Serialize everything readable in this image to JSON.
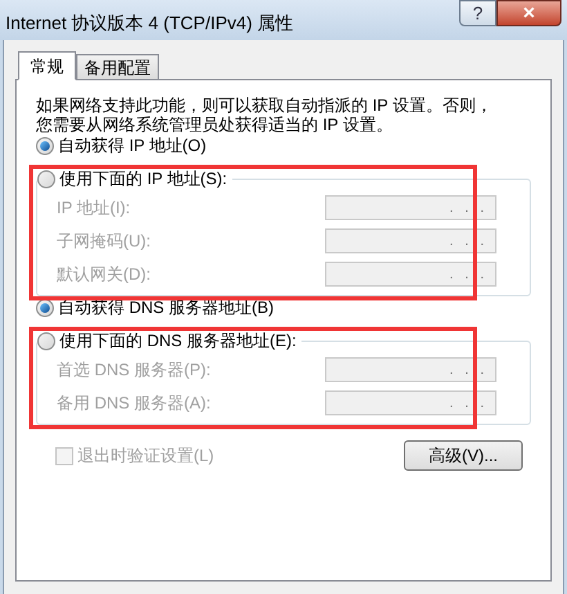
{
  "window": {
    "title": "Internet 协议版本 4 (TCP/IPv4) 属性",
    "help_button": "?",
    "close_button": "×"
  },
  "tabs": [
    {
      "label": "常规",
      "selected": true
    },
    {
      "label": "备用配置",
      "selected": false
    }
  ],
  "description": "如果网络支持此功能，则可以获取自动指派的 IP 设置。否则，您需要从网络系统管理员处获得适当的 IP 设置。",
  "ip_section": {
    "options": [
      {
        "label": "自动获得 IP 地址(O)",
        "selected": true
      },
      {
        "label": "使用下面的 IP 地址(S):",
        "selected": false
      }
    ],
    "highlighted": true,
    "fields": [
      {
        "label": "IP 地址(I):",
        "value": ".   .   .",
        "disabled": true
      },
      {
        "label": "子网掩码(U):",
        "value": ".   .   .",
        "disabled": true
      },
      {
        "label": "默认网关(D):",
        "value": ".   .   .",
        "disabled": true
      }
    ]
  },
  "dns_section": {
    "options": [
      {
        "label": "自动获得 DNS 服务器地址(B)",
        "selected": true
      },
      {
        "label": "使用下面的 DNS 服务器地址(E):",
        "selected": false
      }
    ],
    "highlighted": true,
    "fields": [
      {
        "label": "首选 DNS 服务器(P):",
        "value": ".   .   .",
        "disabled": true
      },
      {
        "label": "备用 DNS 服务器(A):",
        "value": ".   .   .",
        "disabled": true
      }
    ]
  },
  "validate_checkbox": {
    "label": "退出时验证设置(L)",
    "checked": false,
    "disabled": true
  },
  "advanced_button": "高级(V)..."
}
